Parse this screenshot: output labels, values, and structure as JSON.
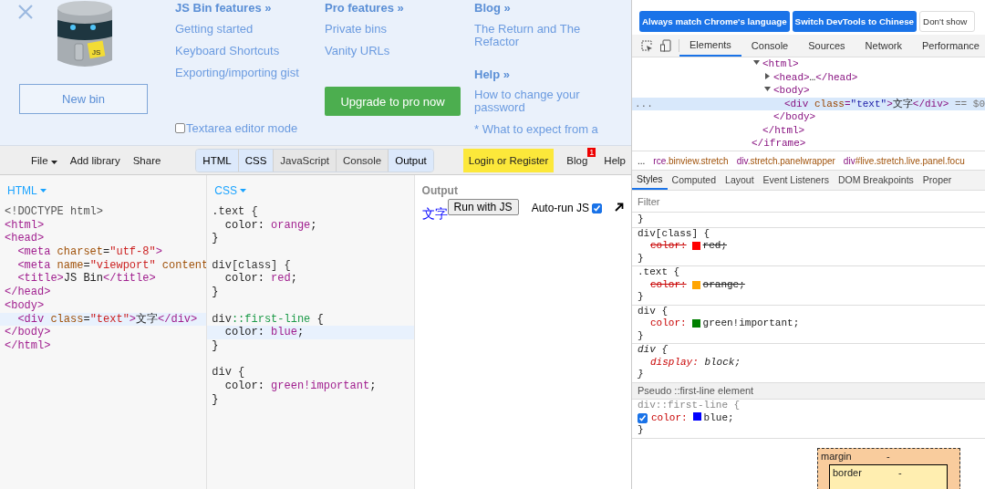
{
  "jsbin_menu": {
    "logo_badge": "JS",
    "new_bin_button": "New bin",
    "features": {
      "heading": "JS Bin features »",
      "links": [
        "Getting started",
        "Keyboard Shortcuts",
        "Exporting/importing gist"
      ]
    },
    "textarea_mode": {
      "label": "Textarea editor mode",
      "checked": false
    },
    "pro": {
      "heading": "Pro features »",
      "links": [
        "Private bins",
        "Vanity URLs"
      ],
      "button": "Upgrade to pro now"
    },
    "blog": {
      "heading": "Blog »",
      "links": [
        "The Return and The Refactor"
      ]
    },
    "help": {
      "heading": "Help »",
      "links": [
        "How to change your password",
        "* What to expect from a"
      ]
    }
  },
  "toolbar": {
    "menus": [
      {
        "label": "File",
        "dropdown": true
      },
      {
        "label": "Add library",
        "dropdown": false
      },
      {
        "label": "Share",
        "dropdown": false
      }
    ],
    "panel_tabs": [
      {
        "label": "HTML",
        "selected": true
      },
      {
        "label": "CSS",
        "selected": true
      },
      {
        "label": "JavaScript",
        "selected": false
      },
      {
        "label": "Console",
        "selected": false
      },
      {
        "label": "Output",
        "selected": true
      }
    ],
    "login": "Login or Register",
    "blog": {
      "label": "Blog",
      "badge": "1"
    },
    "help": "Help"
  },
  "html_panel": {
    "title": "HTML",
    "lines": [
      {
        "kind": "code",
        "highlighted": false,
        "tokens": [
          {
            "kind": "doctype",
            "text": "<!DOCTYPE html>"
          }
        ]
      },
      {
        "kind": "code",
        "highlighted": false,
        "tokens": [
          {
            "kind": "tag",
            "text": "<html>"
          }
        ]
      },
      {
        "kind": "code",
        "highlighted": false,
        "tokens": [
          {
            "kind": "tag",
            "text": "<head>"
          }
        ]
      },
      {
        "kind": "code",
        "highlighted": false,
        "tokens": [
          {
            "kind": "tag",
            "text": "  <meta "
          },
          {
            "kind": "attr",
            "text": "charset"
          },
          {
            "kind": "txt",
            "text": "="
          },
          {
            "kind": "str",
            "text": "\"utf-8\""
          },
          {
            "kind": "tag",
            "text": ">"
          }
        ]
      },
      {
        "kind": "code",
        "highlighted": false,
        "tokens": [
          {
            "kind": "tag",
            "text": "  <meta "
          },
          {
            "kind": "attr",
            "text": "name"
          },
          {
            "kind": "txt",
            "text": "="
          },
          {
            "kind": "str",
            "text": "\"viewport\""
          },
          {
            "kind": "attr",
            "text": " content"
          }
        ]
      },
      {
        "kind": "code",
        "highlighted": false,
        "tokens": [
          {
            "kind": "tag",
            "text": "  <title>"
          },
          {
            "kind": "txt",
            "text": "JS Bin"
          },
          {
            "kind": "tag",
            "text": "</title>"
          }
        ]
      },
      {
        "kind": "code",
        "highlighted": false,
        "tokens": [
          {
            "kind": "tag",
            "text": "</head>"
          }
        ]
      },
      {
        "kind": "code",
        "highlighted": false,
        "tokens": [
          {
            "kind": "tag",
            "text": "<body>"
          }
        ]
      },
      {
        "kind": "code",
        "highlighted": true,
        "tokens": [
          {
            "kind": "tag",
            "text": "  <div "
          },
          {
            "kind": "attr",
            "text": "class"
          },
          {
            "kind": "txt",
            "text": "="
          },
          {
            "kind": "str",
            "text": "\"text\""
          },
          {
            "kind": "tag",
            "text": ">"
          },
          {
            "kind": "txt",
            "text": "文字"
          },
          {
            "kind": "tag",
            "text": "</div>"
          }
        ]
      },
      {
        "kind": "code",
        "highlighted": false,
        "tokens": [
          {
            "kind": "tag",
            "text": "</body>"
          }
        ]
      },
      {
        "kind": "code",
        "highlighted": false,
        "tokens": [
          {
            "kind": "tag",
            "text": "</html>"
          }
        ]
      }
    ]
  },
  "css_panel": {
    "title": "CSS",
    "lines": [
      {
        "kind": "code",
        "highlighted": false,
        "tokens": [
          {
            "kind": "sel",
            "text": ".text {"
          }
        ]
      },
      {
        "kind": "code",
        "highlighted": false,
        "tokens": [
          {
            "kind": "txt",
            "text": "  color: "
          },
          {
            "kind": "val",
            "text": "orange"
          },
          {
            "kind": "txt",
            "text": ";"
          }
        ]
      },
      {
        "kind": "code",
        "highlighted": false,
        "tokens": [
          {
            "kind": "txt",
            "text": "}"
          }
        ]
      },
      {
        "kind": "blank"
      },
      {
        "kind": "code",
        "highlighted": false,
        "tokens": [
          {
            "kind": "sel",
            "text": "div[class] {"
          }
        ]
      },
      {
        "kind": "code",
        "highlighted": false,
        "tokens": [
          {
            "kind": "txt",
            "text": "  color: "
          },
          {
            "kind": "val",
            "text": "red"
          },
          {
            "kind": "txt",
            "text": ";"
          }
        ]
      },
      {
        "kind": "code",
        "highlighted": false,
        "tokens": [
          {
            "kind": "txt",
            "text": "}"
          }
        ]
      },
      {
        "kind": "blank"
      },
      {
        "kind": "code",
        "highlighted": false,
        "tokens": [
          {
            "kind": "sel",
            "text": "div"
          },
          {
            "kind": "pseudo",
            "text": "::first-line"
          },
          {
            "kind": "txt",
            "text": " {"
          }
        ]
      },
      {
        "kind": "code",
        "highlighted": true,
        "tokens": [
          {
            "kind": "txt",
            "text": "  color: "
          },
          {
            "kind": "val",
            "text": "blue"
          },
          {
            "kind": "txt",
            "text": ";"
          }
        ]
      },
      {
        "kind": "code",
        "highlighted": false,
        "tokens": [
          {
            "kind": "txt",
            "text": "}"
          }
        ]
      },
      {
        "kind": "blank"
      },
      {
        "kind": "code",
        "highlighted": false,
        "tokens": [
          {
            "kind": "sel",
            "text": "div {"
          }
        ]
      },
      {
        "kind": "code",
        "highlighted": false,
        "tokens": [
          {
            "kind": "txt",
            "text": "  color: "
          },
          {
            "kind": "val",
            "text": "green!important"
          },
          {
            "kind": "txt",
            "text": ";"
          }
        ]
      },
      {
        "kind": "code",
        "highlighted": false,
        "tokens": [
          {
            "kind": "txt",
            "text": "}"
          }
        ]
      }
    ]
  },
  "output_panel": {
    "title": "Output",
    "rendered_text": "文字",
    "run_button": "Run with JS",
    "autorun": {
      "label": "Auto-run JS",
      "checked": true
    }
  },
  "devtools": {
    "banner_buttons": [
      {
        "label": "Always match Chrome's language",
        "kind": "primary"
      },
      {
        "label": "Switch DevTools to Chinese",
        "kind": "primary"
      },
      {
        "label": "Don't show",
        "kind": "plain"
      }
    ],
    "tabs": [
      {
        "label": "Elements",
        "selected": true
      },
      {
        "label": "Console",
        "selected": false
      },
      {
        "label": "Sources",
        "selected": false
      },
      {
        "label": "Network",
        "selected": false
      },
      {
        "label": "Performance",
        "selected": false
      }
    ],
    "dom_tree": {
      "close": [
        {
          "kind": "tag",
          "text": "</iframe>"
        }
      ],
      "children": [
        {
          "selected": false,
          "expanded": true,
          "open": [
            {
              "kind": "tag",
              "text": "<html>"
            }
          ],
          "close": [
            {
              "kind": "tag",
              "text": "</html>"
            }
          ],
          "children": [
            {
              "selected": false,
              "expanded": false,
              "open": [
                {
                  "kind": "tag",
                  "text": "<head>"
                },
                {
                  "kind": "txt",
                  "text": "…"
                },
                {
                  "kind": "tag",
                  "text": "</head>"
                }
              ]
            },
            {
              "selected": false,
              "expanded": true,
              "open": [
                {
                  "kind": "tag",
                  "text": "<body>"
                }
              ],
              "close": [
                {
                  "kind": "tag",
                  "text": "</body>"
                }
              ],
              "children": [
                {
                  "selected": true,
                  "open": [
                    {
                      "kind": "tag",
                      "text": "<div "
                    },
                    {
                      "kind": "attr",
                      "text": "class"
                    },
                    {
                      "kind": "tag",
                      "text": "="
                    },
                    {
                      "kind": "str",
                      "text": "\"text\""
                    },
                    {
                      "kind": "tag",
                      "text": ">"
                    },
                    {
                      "kind": "txt",
                      "text": "文字"
                    },
                    {
                      "kind": "tag",
                      "text": "</div>"
                    },
                    {
                      "kind": "hint",
                      "text": " == $0"
                    }
                  ]
                }
              ]
            }
          ]
        }
      ]
    },
    "selection_dots": "...",
    "breadcrumb_more": "...",
    "breadcrumbs": [
      {
        "tag": "rce",
        "classes": ".binview.stretch"
      },
      {
        "tag": "div",
        "classes": ".stretch.panelwrapper"
      },
      {
        "tag": "div",
        "classes": "#live.stretch.live.panel.focu"
      }
    ],
    "sub_tabs": [
      {
        "label": "Styles",
        "selected": true
      },
      {
        "label": "Computed",
        "selected": false
      },
      {
        "label": "Layout",
        "selected": false
      },
      {
        "label": "Event Listeners",
        "selected": false
      },
      {
        "label": "DOM Breakpoints",
        "selected": false
      },
      {
        "label": "Proper",
        "selected": false
      }
    ],
    "filter": {
      "placeholder": "Filter"
    },
    "rules": [
      {
        "close": "}"
      },
      {
        "selector": "div[class] {",
        "italic": false,
        "declarations": [
          {
            "prop": "color:",
            "value": "red;",
            "color": "#ff0000",
            "overridden": true
          }
        ],
        "close": "}"
      },
      {
        "selector": ".text {",
        "italic": false,
        "declarations": [
          {
            "prop": "color:",
            "value": "orange;",
            "color": "#ffa500",
            "overridden": true
          }
        ],
        "close": "}"
      },
      {
        "selector": "div {",
        "italic": false,
        "declarations": [
          {
            "prop": "color:",
            "value": "green!important;",
            "color": "#008000",
            "overridden": false
          }
        ],
        "close": "}"
      },
      {
        "selector": "div {",
        "italic": true,
        "declarations": [
          {
            "prop": "display:",
            "value": "block;",
            "overridden": false
          }
        ],
        "close": "}"
      }
    ],
    "pseudo_header": "Pseudo ::first-line element",
    "pseudo_rule": {
      "selector": "div::first-line {",
      "declarations": [
        {
          "prop": "color:",
          "value": "blue;",
          "color": "#0000ff",
          "checked": true
        }
      ],
      "close": "}"
    },
    "box_model": {
      "margin_label": "margin",
      "margin_value": "-",
      "border_label": "border",
      "border_value": "-"
    }
  }
}
